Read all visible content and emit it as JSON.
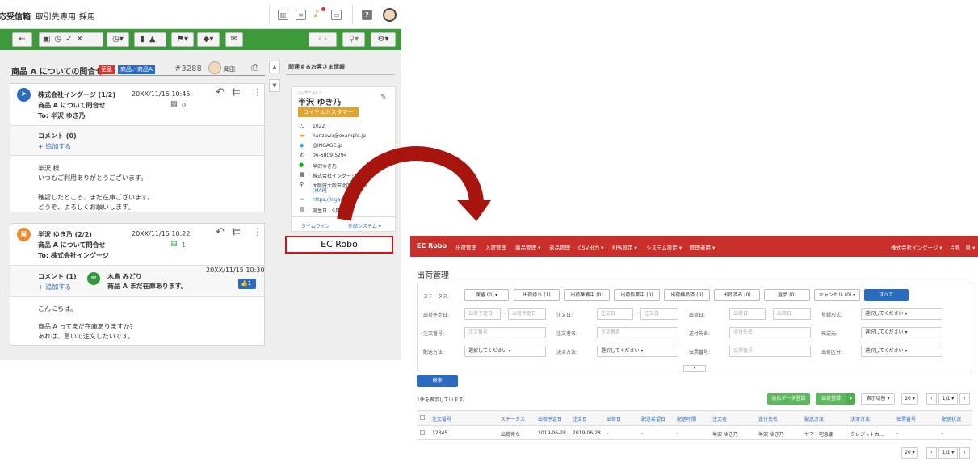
{
  "top_nav": {
    "tabs": [
      "応受信箱",
      "取引先専用",
      "採用"
    ]
  },
  "thread": {
    "title": "商品 A についての問合せ",
    "tags": [
      "至急",
      "商品／商品A"
    ],
    "ticket_id": "#3288",
    "assignee": "岡田"
  },
  "customer_panel": {
    "section_title": "関連するお客さま情報",
    "furigana": "ハンザワ ユキノ",
    "name": "半沢 ゆき乃",
    "badge": "ロイヤルカスタマー",
    "fields": [
      "1022",
      "hanzawa@example.jp",
      "@INGAGE.jp",
      "06-6809-5294",
      "半沢ゆき乃",
      "株式会社イングージ",
      "大阪府大阪市北区...14-6"
    ],
    "map_link": "[MAP]",
    "url": "https://ingage...",
    "birthday": "誕生日　9月18日...",
    "tab_timeline": "タイムライン",
    "tab_external": "外部システム ▾"
  },
  "mail1": {
    "from": "株式会社イングージ (1/2)",
    "date": "20XX/11/15 10:45",
    "subject": "商品 A について問合せ",
    "to": "To: 半沢 ゆき乃",
    "comment_count": "0",
    "comments_label": "コメント (0)",
    "add_label": "+ 追加する",
    "body": [
      "半沢 様",
      "いつもご利用ありがとうございます。",
      "",
      "確認したところ、まだ在庫ございます。",
      "どうぞ、よろしくお願いします。"
    ]
  },
  "mail2": {
    "from": "半沢 ゆき乃 (2/2)",
    "date": "20XX/11/15 10:22",
    "subject": "商品 A について問合せ",
    "to": "To: 株式会社イングージ",
    "comment_count": "1",
    "comments_label": "コメント (1)",
    "add_label": "+ 追加する",
    "comment_author": "木島 みどり",
    "comment_date": "20XX/11/15 10:30",
    "comment_text": "商品 A まだ在庫あります。",
    "like_count": "1",
    "body": [
      "こんにちは。",
      "",
      "商品 A ってまだ在庫ありますか？",
      "あれば、急いで注文したいです。"
    ]
  },
  "callout": {
    "label": "EC Robo"
  },
  "ecrobo": {
    "brand": "EC Robo",
    "nav": [
      "出荷管理",
      "入荷管理",
      "商品管理 ▾",
      "返品管理",
      "CSV出力 ▾",
      "RPA設定 ▾",
      "システム設定 ▾",
      "管理者用 ▾"
    ],
    "company": "株式会社イングージ ▾",
    "user": "片貝　恵 ▾",
    "page_title": "出荷管理",
    "status_label": "ステータス:",
    "status_buttons": [
      "保留 (0) ▾",
      "出荷待ち (1)",
      "出荷準備中 (0)",
      "出荷作業中 (0)",
      "出荷検品済 (0)",
      "出荷済み (0)",
      "返品 (0)",
      "キャンセル (0) ▾",
      "すべて"
    ],
    "filters": {
      "row1": {
        "ship_plan_label": "出荷予定日:",
        "ship_plan_ph": "出荷予定日",
        "order_date_label": "注文日:",
        "order_date_ph": "注文日",
        "ship_date_label": "出荷日:",
        "ship_date_ph": "出荷日",
        "reg_type_label": "登録形式:",
        "reg_type_val": "選択してください ▾"
      },
      "row2": {
        "order_no_label": "注文番号:",
        "order_no_ph": "注文番号",
        "orderer_label": "注文者名:",
        "orderer_ph": "注文者名",
        "dest_label": "送付先名:",
        "dest_ph": "送付先名",
        "origin_label": "発送元:",
        "origin_val": "選択してください ▾"
      },
      "row3": {
        "delivery_label": "配送方法:",
        "delivery_val": "選択してください ▾",
        "payment_label": "決済方法:",
        "payment_val": "選択してください ▾",
        "slip_label": "伝票番号:",
        "slip_ph": "伝票番号",
        "ship_type_label": "出荷区分:",
        "ship_type_val": "選択してください ▾"
      }
    },
    "search_button": "検索",
    "result_count": "1件を表示しています。",
    "actions": [
      "後払データ登録",
      "出荷登録",
      "表示切替 ▾",
      "20 ▾",
      "1/1 ▾"
    ],
    "table_headers": [
      "注文番号",
      "ステータス",
      "出荷予定日",
      "注文日",
      "出荷日",
      "配送希望日",
      "配送時間",
      "注文者",
      "送付先名",
      "配送方法",
      "決済方法",
      "伝票番号",
      "配送状況"
    ],
    "table_rows": [
      [
        "12345",
        "出荷待ち",
        "2019-06-28",
        "2019-06-28",
        "-",
        "-",
        "-",
        "半沢 ゆき乃",
        "半沢 ゆき乃",
        "ヤマト宅急便",
        "クレジットカ...",
        "-",
        "-"
      ]
    ],
    "bottom_pager": [
      "20 ▾",
      "1/1 ▾"
    ]
  },
  "colors": {
    "toolbar_green": "#3d9a3a",
    "ecrobo_red": "#c9302c",
    "arrow_red": "#a8140e",
    "primary_blue": "#2a6bbf",
    "badge_orange": "#e3a22a"
  }
}
